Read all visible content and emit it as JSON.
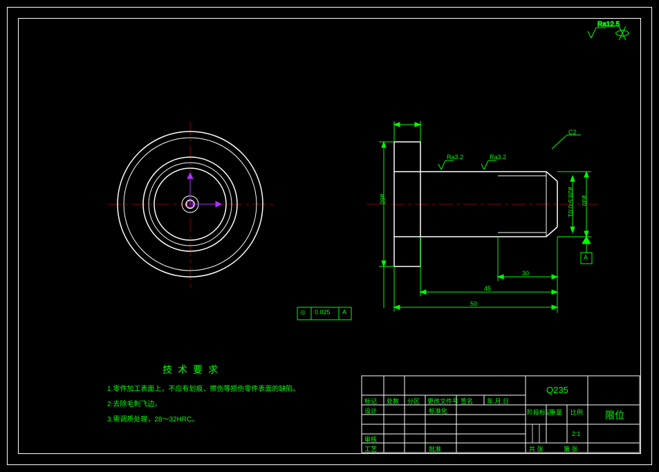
{
  "surface_roughness": {
    "general": "Ra12.5",
    "shaft1": "Ra3.2",
    "shaft2": "Ra3.2"
  },
  "chamfer": "C2",
  "dimensions": {
    "diameter_flange": "ø60",
    "diameter_step": "ø28.5-0.01",
    "diameter_shaft": "ø30",
    "length_30": "30",
    "length_45": "45",
    "length_50": "50"
  },
  "gdt": {
    "symbol": "◎",
    "tolerance": "0.025",
    "datum": "A",
    "datum_label": "A"
  },
  "notes": {
    "heading": "技术要求",
    "line1": "1.零件加工表面上，不应有划痕、擦伤等损伤零件表面的缺陷。",
    "line2": "2.去除毛刺飞边。",
    "line3": "3.需调质处理，28～32HRC。"
  },
  "title_block": {
    "material": "Q235",
    "part_name": "限位",
    "scale": "2:1",
    "row_labels": {
      "mark": "标记",
      "qty": "处数",
      "zone": "分区",
      "change_doc": "更改文件号",
      "sign": "签名",
      "date": "年.月.日",
      "design": "设计",
      "standardize": "标准化",
      "audit": "审核",
      "process": "工艺",
      "approve": "批准",
      "stage_mark": "阶段标记",
      "mass": "重量",
      "ratio": "比例",
      "sheet_total": "共   张",
      "sheet_no": "第   张"
    }
  }
}
